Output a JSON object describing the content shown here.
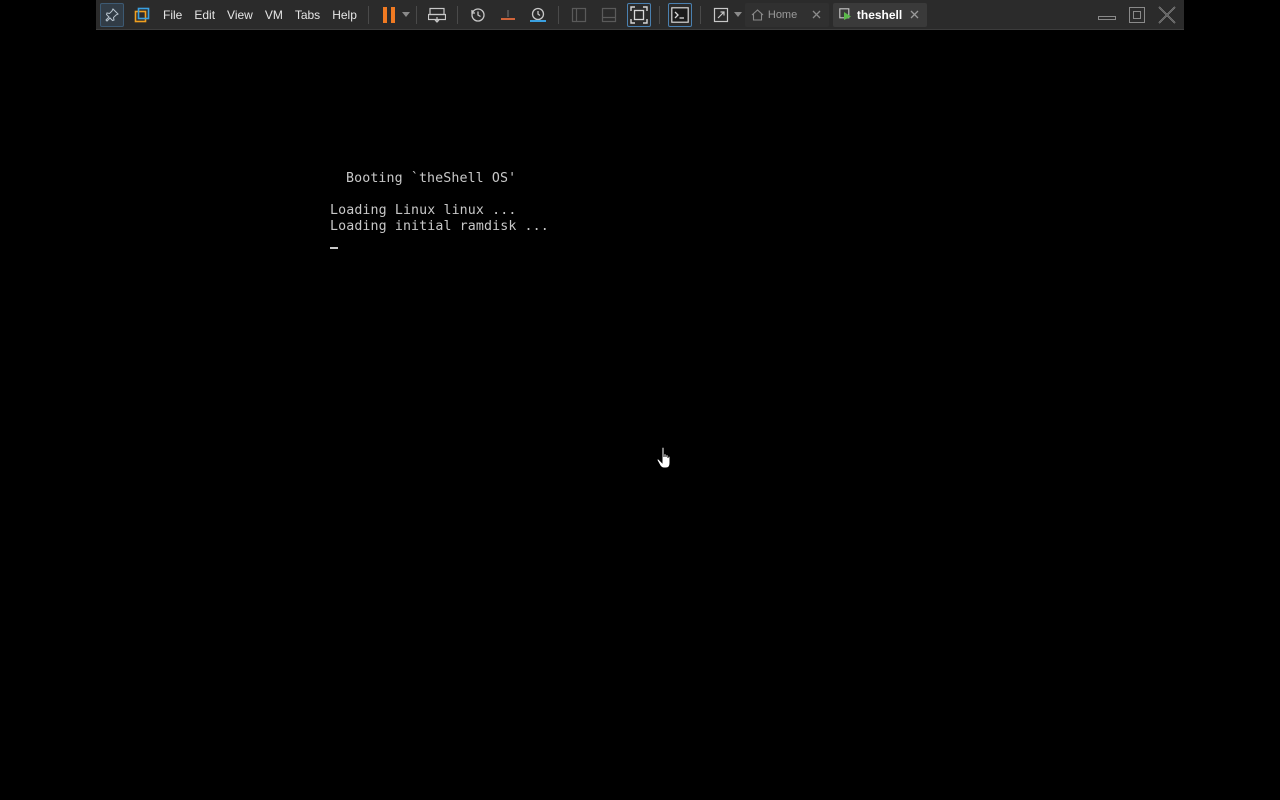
{
  "menu": {
    "file": "File",
    "edit": "Edit",
    "view": "View",
    "vm": "VM",
    "tabs": "Tabs",
    "help": "Help"
  },
  "tabs": {
    "home": "Home",
    "current": "theshell"
  },
  "console": {
    "boot_title": "Booting `theShell OS'",
    "line_1": "Loading Linux linux ...",
    "line_2": "Loading initial ramdisk ..."
  },
  "colors": {
    "pause_orange": "#f07a22",
    "toolbar_bg": "#2b2b2b",
    "console_text": "#c8c8c8",
    "active_tab_icon": "#5bb84a"
  },
  "icons": [
    "pin-icon",
    "library-icon",
    "pause-icon",
    "send-keys-icon",
    "snapshot-icon",
    "revert-snapshot-icon",
    "snapshot-manager-icon",
    "sidebar-toggle-icon",
    "thumbnail-bar-icon",
    "fit-guest-icon",
    "console-icon",
    "fullscreen-icon",
    "home-icon",
    "vm-tab-icon",
    "minimize-icon",
    "restore-icon",
    "close-icon"
  ]
}
